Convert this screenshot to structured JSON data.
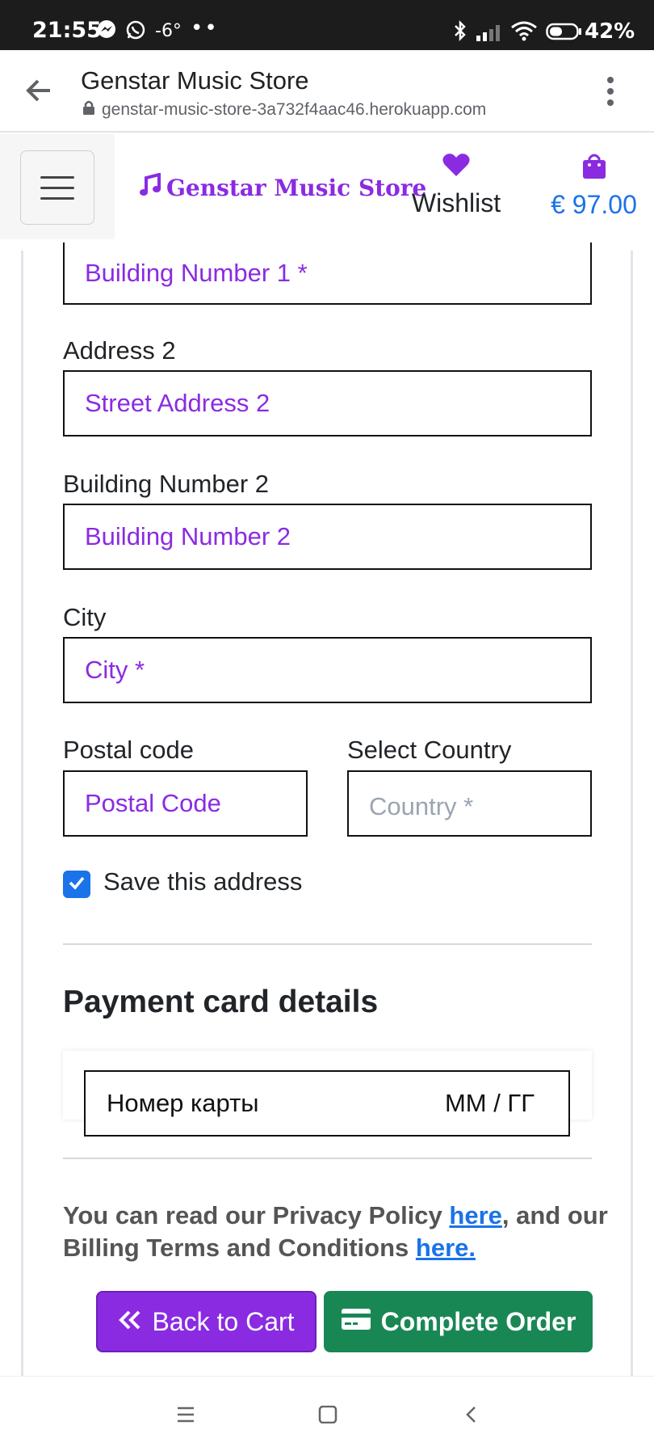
{
  "status_bar": {
    "time": "21:55",
    "temperature": "-6°",
    "extra_dots": "••",
    "battery": "42%"
  },
  "browser": {
    "page_title": "Genstar Music Store",
    "url": "genstar-music-store-3a732f4aac46.herokuapp.com"
  },
  "header": {
    "brand": "Genstar Music Store",
    "wishlist_label": "Wishlist",
    "cart_total": "€ 97.00",
    "brand_color": "#8a2be2"
  },
  "form": {
    "building1_value": "Building Number 1 *",
    "address2_label": "Address 2",
    "address2_value": "Street Address 2",
    "building2_label": "Building Number 2",
    "building2_value": "Building Number 2",
    "city_label": "City",
    "city_value": "City *",
    "postal_label": "Postal code",
    "postal_value": "Postal Code",
    "country_label": "Select Country",
    "country_placeholder": "Country *",
    "save_address_label": "Save this address",
    "save_address_checked": true
  },
  "payment": {
    "title": "Payment card details",
    "card_number_placeholder": "Номер карты",
    "expiry_placeholder": "ММ / ГГ"
  },
  "policy": {
    "text_1": "You can read our Privacy Policy ",
    "link_1": "here",
    "text_2": ", and our Billing Terms and Conditions ",
    "link_2": "here."
  },
  "buttons": {
    "back_label": "Back to Cart",
    "complete_label": "Complete Order",
    "back_color": "#8a2be2",
    "complete_color": "#198754"
  }
}
